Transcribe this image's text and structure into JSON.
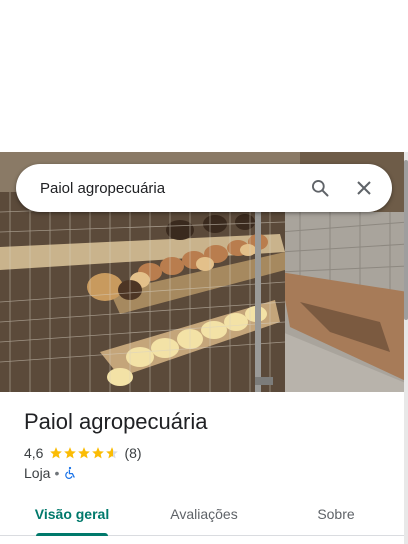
{
  "search": {
    "query": "Paiol agropecuária",
    "search_icon": "search-icon",
    "close_icon": "close-icon"
  },
  "photo": {
    "subject": "chicks-in-cages-photo"
  },
  "place": {
    "name": "Paiol agropecuária",
    "rating": "4,6",
    "rating_value": 4.6,
    "review_count": "(8)",
    "category": "Loja",
    "separator": "•",
    "accessibility_icon": "wheelchair-icon",
    "star_color": "#fbbc04",
    "accessibility_color": "#1a73e8"
  },
  "tabs": [
    {
      "label": "Visão geral",
      "active": true
    },
    {
      "label": "Avaliações",
      "active": false
    },
    {
      "label": "Sobre",
      "active": false
    }
  ],
  "accent_color": "#00796b"
}
